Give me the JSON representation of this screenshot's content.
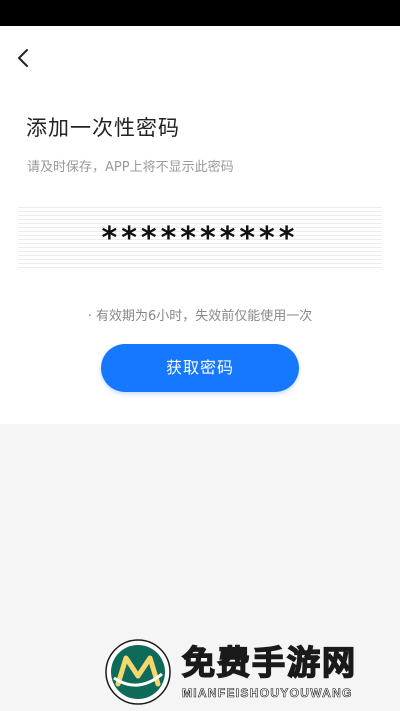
{
  "header": {
    "back_icon": "chevron-left-icon"
  },
  "page": {
    "title": "添加一次性密码",
    "subtitle": "请及时保存，APP上将不显示此密码",
    "password_mask": "**********",
    "validity_note": "· 有效期为6小时，失效前仅能使用一次",
    "get_password_label": "获取密码"
  },
  "colors": {
    "accent": "#1677ff",
    "background": "#f5f5f5",
    "card": "#ffffff"
  },
  "watermark": {
    "text_cn": "免费手游网",
    "text_en": "MIANFEISHOUYOUWANG"
  }
}
